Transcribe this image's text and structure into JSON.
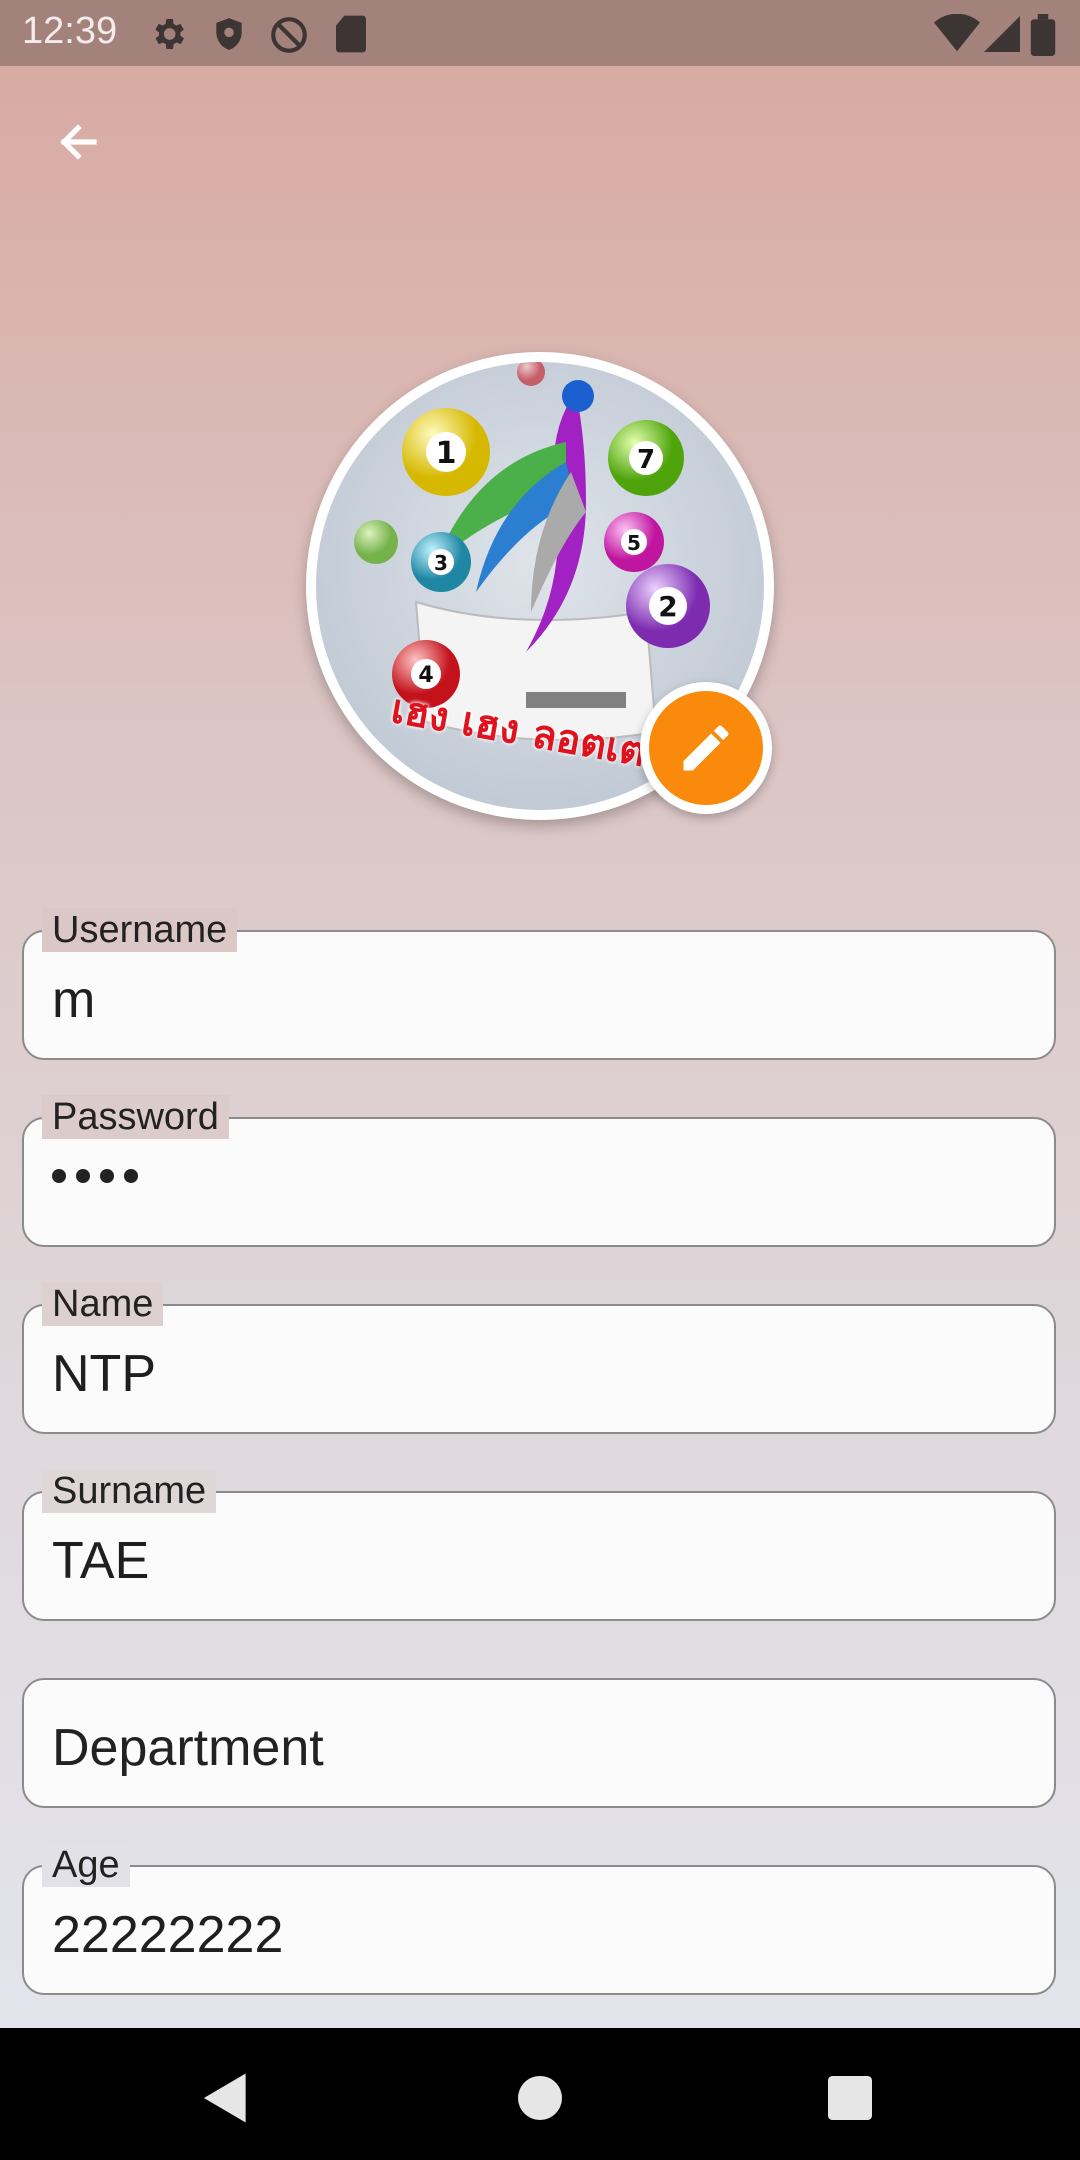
{
  "status_bar": {
    "time": "12:39",
    "left_icons": [
      "gear-icon",
      "shield-icon",
      "no-sync-icon",
      "sd-card-icon"
    ],
    "right_icons": [
      "wifi-icon",
      "signal-icon",
      "battery-icon"
    ]
  },
  "app_bar": {
    "back_icon": "arrow-left-icon"
  },
  "avatar": {
    "logo_text": "เฮง เฮง ลอตเตอรี่",
    "edit_icon": "pencil-icon",
    "accent_color": "#f98a0c"
  },
  "form": {
    "username": {
      "label": "Username",
      "value": "m"
    },
    "password": {
      "label": "Password",
      "masked_length": 4
    },
    "name": {
      "label": "Name",
      "value": "NTP"
    },
    "surname": {
      "label": "Surname",
      "value": "TAE"
    },
    "department": {
      "placeholder": "Department"
    },
    "age": {
      "label": "Age",
      "value": "22222222"
    }
  },
  "nav_bar": {
    "icons": [
      "back-triangle-icon",
      "home-circle-icon",
      "recents-square-icon"
    ]
  }
}
